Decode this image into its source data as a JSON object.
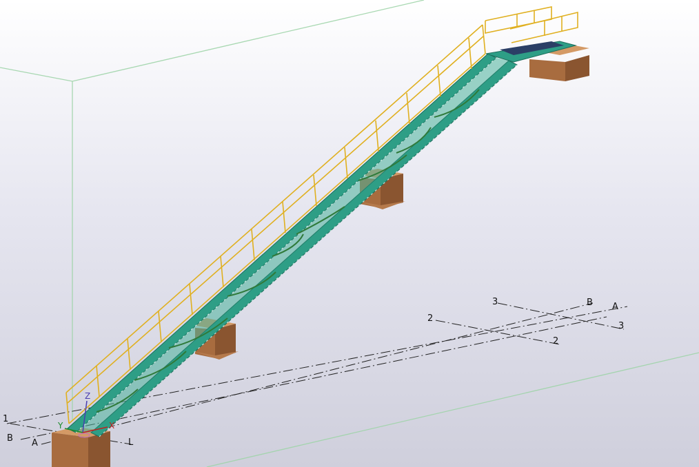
{
  "view": {
    "background_top": "#ffffff",
    "background_bottom": "#cfcfdc",
    "work_area_color": "#9fd4a8"
  },
  "model": {
    "objects": [
      "stair-stringer",
      "handrail",
      "concrete-pad-footing",
      "top-landing"
    ],
    "colors": {
      "stringer": "#2e9e86",
      "handrail": "#e0b020",
      "concrete": "#b57a4c",
      "landing_deck": "#2b3f66"
    }
  },
  "grid_labels": {
    "g1": "1",
    "gB_left": "B",
    "gA_left": "A",
    "gL": "L",
    "g2_left": "2",
    "g2_right": "2",
    "g3_left": "3",
    "g3_right": "3",
    "gB_right": "B",
    "gA_right": "A"
  },
  "axis_labels": {
    "z": "Z",
    "y": "Y",
    "x": "X",
    "z_color": "#4a3fb0",
    "y_color": "#1a8a2a",
    "x_color": "#c02020"
  }
}
